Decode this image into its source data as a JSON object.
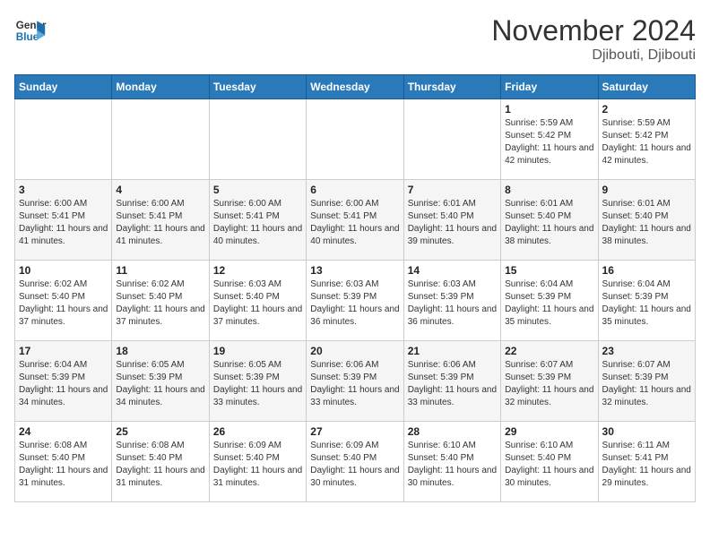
{
  "logo": {
    "line1": "General",
    "line2": "Blue"
  },
  "title": "November 2024",
  "subtitle": "Djibouti, Djibouti",
  "weekdays": [
    "Sunday",
    "Monday",
    "Tuesday",
    "Wednesday",
    "Thursday",
    "Friday",
    "Saturday"
  ],
  "weeks": [
    [
      {
        "day": "",
        "info": ""
      },
      {
        "day": "",
        "info": ""
      },
      {
        "day": "",
        "info": ""
      },
      {
        "day": "",
        "info": ""
      },
      {
        "day": "",
        "info": ""
      },
      {
        "day": "1",
        "info": "Sunrise: 5:59 AM\nSunset: 5:42 PM\nDaylight: 11 hours and 42 minutes."
      },
      {
        "day": "2",
        "info": "Sunrise: 5:59 AM\nSunset: 5:42 PM\nDaylight: 11 hours and 42 minutes."
      }
    ],
    [
      {
        "day": "3",
        "info": "Sunrise: 6:00 AM\nSunset: 5:41 PM\nDaylight: 11 hours and 41 minutes."
      },
      {
        "day": "4",
        "info": "Sunrise: 6:00 AM\nSunset: 5:41 PM\nDaylight: 11 hours and 41 minutes."
      },
      {
        "day": "5",
        "info": "Sunrise: 6:00 AM\nSunset: 5:41 PM\nDaylight: 11 hours and 40 minutes."
      },
      {
        "day": "6",
        "info": "Sunrise: 6:00 AM\nSunset: 5:41 PM\nDaylight: 11 hours and 40 minutes."
      },
      {
        "day": "7",
        "info": "Sunrise: 6:01 AM\nSunset: 5:40 PM\nDaylight: 11 hours and 39 minutes."
      },
      {
        "day": "8",
        "info": "Sunrise: 6:01 AM\nSunset: 5:40 PM\nDaylight: 11 hours and 38 minutes."
      },
      {
        "day": "9",
        "info": "Sunrise: 6:01 AM\nSunset: 5:40 PM\nDaylight: 11 hours and 38 minutes."
      }
    ],
    [
      {
        "day": "10",
        "info": "Sunrise: 6:02 AM\nSunset: 5:40 PM\nDaylight: 11 hours and 37 minutes."
      },
      {
        "day": "11",
        "info": "Sunrise: 6:02 AM\nSunset: 5:40 PM\nDaylight: 11 hours and 37 minutes."
      },
      {
        "day": "12",
        "info": "Sunrise: 6:03 AM\nSunset: 5:40 PM\nDaylight: 11 hours and 37 minutes."
      },
      {
        "day": "13",
        "info": "Sunrise: 6:03 AM\nSunset: 5:39 PM\nDaylight: 11 hours and 36 minutes."
      },
      {
        "day": "14",
        "info": "Sunrise: 6:03 AM\nSunset: 5:39 PM\nDaylight: 11 hours and 36 minutes."
      },
      {
        "day": "15",
        "info": "Sunrise: 6:04 AM\nSunset: 5:39 PM\nDaylight: 11 hours and 35 minutes."
      },
      {
        "day": "16",
        "info": "Sunrise: 6:04 AM\nSunset: 5:39 PM\nDaylight: 11 hours and 35 minutes."
      }
    ],
    [
      {
        "day": "17",
        "info": "Sunrise: 6:04 AM\nSunset: 5:39 PM\nDaylight: 11 hours and 34 minutes."
      },
      {
        "day": "18",
        "info": "Sunrise: 6:05 AM\nSunset: 5:39 PM\nDaylight: 11 hours and 34 minutes."
      },
      {
        "day": "19",
        "info": "Sunrise: 6:05 AM\nSunset: 5:39 PM\nDaylight: 11 hours and 33 minutes."
      },
      {
        "day": "20",
        "info": "Sunrise: 6:06 AM\nSunset: 5:39 PM\nDaylight: 11 hours and 33 minutes."
      },
      {
        "day": "21",
        "info": "Sunrise: 6:06 AM\nSunset: 5:39 PM\nDaylight: 11 hours and 33 minutes."
      },
      {
        "day": "22",
        "info": "Sunrise: 6:07 AM\nSunset: 5:39 PM\nDaylight: 11 hours and 32 minutes."
      },
      {
        "day": "23",
        "info": "Sunrise: 6:07 AM\nSunset: 5:39 PM\nDaylight: 11 hours and 32 minutes."
      }
    ],
    [
      {
        "day": "24",
        "info": "Sunrise: 6:08 AM\nSunset: 5:40 PM\nDaylight: 11 hours and 31 minutes."
      },
      {
        "day": "25",
        "info": "Sunrise: 6:08 AM\nSunset: 5:40 PM\nDaylight: 11 hours and 31 minutes."
      },
      {
        "day": "26",
        "info": "Sunrise: 6:09 AM\nSunset: 5:40 PM\nDaylight: 11 hours and 31 minutes."
      },
      {
        "day": "27",
        "info": "Sunrise: 6:09 AM\nSunset: 5:40 PM\nDaylight: 11 hours and 30 minutes."
      },
      {
        "day": "28",
        "info": "Sunrise: 6:10 AM\nSunset: 5:40 PM\nDaylight: 11 hours and 30 minutes."
      },
      {
        "day": "29",
        "info": "Sunrise: 6:10 AM\nSunset: 5:40 PM\nDaylight: 11 hours and 30 minutes."
      },
      {
        "day": "30",
        "info": "Sunrise: 6:11 AM\nSunset: 5:41 PM\nDaylight: 11 hours and 29 minutes."
      }
    ]
  ]
}
